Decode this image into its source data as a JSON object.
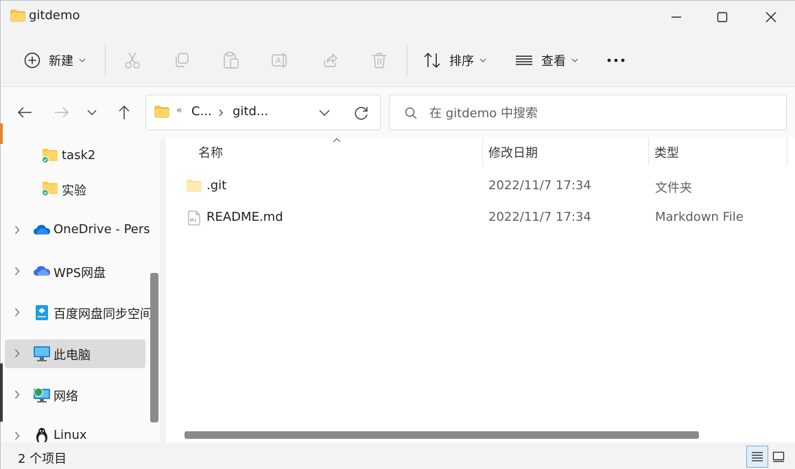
{
  "window": {
    "title": "gitdemo"
  },
  "toolbar": {
    "new_label": "新建",
    "sort_label": "排序",
    "view_label": "查看"
  },
  "nav": {
    "breadcrumb_root": "C...",
    "breadcrumb_current": "gitd..."
  },
  "search": {
    "placeholder": "在 gitdemo 中搜索"
  },
  "sidebar": {
    "items": [
      {
        "label": "task2",
        "icon": "folder-synced-icon"
      },
      {
        "label": "实验",
        "icon": "folder-synced-icon"
      },
      {
        "label": "OneDrive - Pers",
        "icon": "onedrive-cloud-icon"
      },
      {
        "label": "WPS网盘",
        "icon": "wps-cloud-icon"
      },
      {
        "label": "百度网盘同步空间",
        "icon": "baidu-netdisk-icon"
      },
      {
        "label": "此电脑",
        "icon": "computer-icon",
        "selected": true
      },
      {
        "label": "网络",
        "icon": "network-icon"
      },
      {
        "label": "Linux",
        "icon": "linux-penguin-icon"
      }
    ]
  },
  "columns": {
    "name": "名称",
    "modified": "修改日期",
    "type": "类型"
  },
  "files": [
    {
      "name": ".git",
      "modified": "2022/11/7 17:34",
      "type": "文件夹",
      "icon": "folder-icon"
    },
    {
      "name": "README.md",
      "modified": "2022/11/7 17:34",
      "type": "Markdown File",
      "icon": "markdown-file-icon"
    }
  ],
  "status": {
    "item_count": "2 个项目"
  },
  "colors": {
    "folder": "#f7c948",
    "accent": "#0067c0",
    "selected_bg": "#dcdcdc"
  }
}
